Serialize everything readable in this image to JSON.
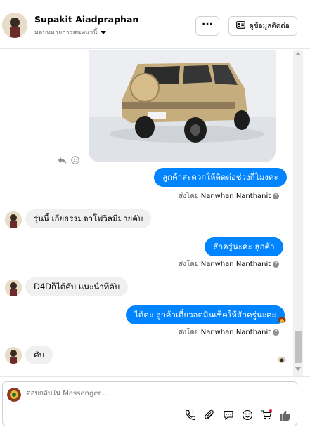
{
  "header": {
    "contact_name": "Supakit Aiadpraphan",
    "assign_label": "มอบหมายการสนทนานี้",
    "more_label": "···",
    "contact_info_label": "ดูข้อมูลติดต่อ"
  },
  "messages": [
    {
      "id": "m1",
      "direction": "outgoing",
      "text": "ลูกค้าสะดวกให้ติดต่อช่วงกี่โมงคะ",
      "sent_by_prefix": "ส่งโดย",
      "agent": "Nanwhan Nanthanit"
    },
    {
      "id": "m2",
      "direction": "incoming",
      "text": "รุ่นนี้ เกียธรรมดาโฟวิลมีม่ายคับ"
    },
    {
      "id": "m3",
      "direction": "outgoing",
      "text": "สักครู่นะคะ ลูกค้า",
      "sent_by_prefix": "ส่งโดย",
      "agent": "Nanwhan Nanthanit"
    },
    {
      "id": "m4",
      "direction": "incoming",
      "text": "D4Dก็ได้คับ แนะนำทีคับ"
    },
    {
      "id": "m5",
      "direction": "outgoing",
      "text": "ได้ค่ะ ลูกค้าเดี๋ยวอดมินเช็คให้สักครู่นะคะ",
      "sent_by_prefix": "ส่งโดย",
      "agent": "Nanwhan Nanthanit"
    },
    {
      "id": "m6",
      "direction": "incoming",
      "text": "คับ"
    }
  ],
  "composer": {
    "placeholder": "ตอบกลับใน Messenger..."
  },
  "icons": {
    "reply": "reply-icon",
    "react": "smiley-icon",
    "call": "phone-plus-icon",
    "attach": "paperclip-icon",
    "saved_reply": "chat-bubble-icon",
    "emoji": "emoji-icon",
    "shop": "cart-icon",
    "like": "thumbs-up-icon"
  },
  "colors": {
    "outgoing_bubble": "#0084ff",
    "incoming_bubble": "#f0f0f0",
    "like_icon": "#65676b"
  }
}
